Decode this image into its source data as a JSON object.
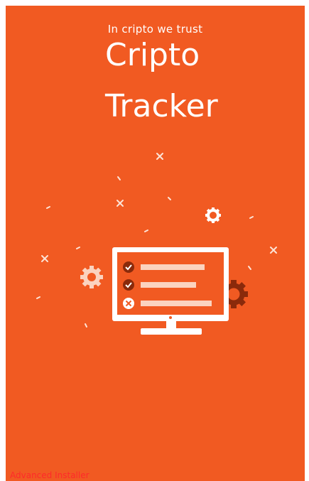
{
  "splash": {
    "tagline": "In cripto we trust",
    "title_line1": "Cripto",
    "title_line2": "Tracker",
    "footer_brand": "Advanced Installer",
    "background_color": "#f15a22",
    "accent_dark": "#8a2a0b",
    "text_color": "#ffffff",
    "brand_color": "#ff2a2a"
  },
  "illustration": {
    "icon": "monitor-checklist-icon",
    "items": [
      {
        "status": "check",
        "icon": "check-circle-icon"
      },
      {
        "status": "check",
        "icon": "check-circle-icon"
      },
      {
        "status": "cross",
        "icon": "x-circle-icon"
      }
    ],
    "decorations": [
      "gear-icon",
      "sparkle-icon"
    ]
  }
}
